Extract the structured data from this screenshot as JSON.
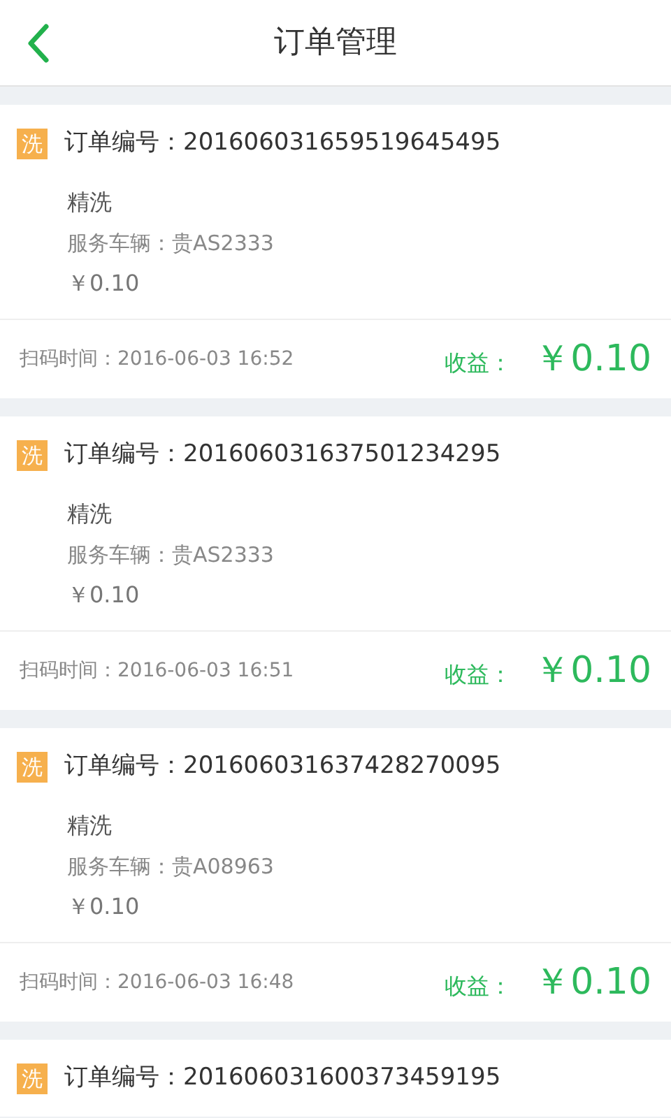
{
  "header": {
    "title": "订单管理"
  },
  "orders": [
    {
      "badge": "洗",
      "order_no": "订单编号：201606031659519645495",
      "service": "精洗",
      "vehicle": "服务车辆：贵AS2333",
      "price": "￥0.10",
      "scan_time": "扫码时间：2016-06-03 16:52",
      "income_label": "收益：",
      "income": "￥0.10"
    },
    {
      "badge": "洗",
      "order_no": "订单编号：201606031637501234295",
      "service": "精洗",
      "vehicle": "服务车辆：贵AS2333",
      "price": "￥0.10",
      "scan_time": "扫码时间：2016-06-03 16:51",
      "income_label": "收益：",
      "income": "￥0.10"
    },
    {
      "badge": "洗",
      "order_no": "订单编号：201606031637428270095",
      "service": "精洗",
      "vehicle": "服务车辆：贵A08963",
      "price": "￥0.10",
      "scan_time": "扫码时间：2016-06-03 16:48",
      "income_label": "收益：",
      "income": "￥0.10"
    },
    {
      "badge": "洗",
      "order_no": "订单编号：201606031600373459195"
    }
  ]
}
